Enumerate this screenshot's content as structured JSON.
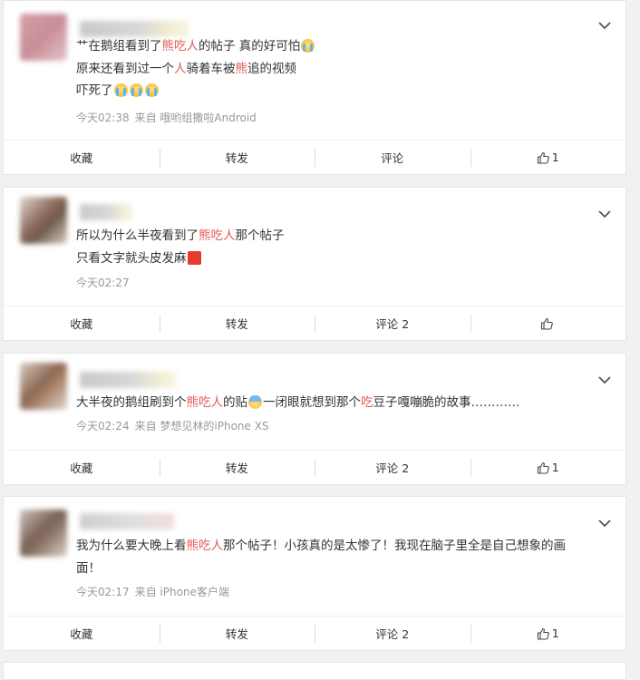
{
  "theme": {
    "highlight": "#e35b5b",
    "meta_text": "#999999",
    "background": "#f1f1f1"
  },
  "icons": {
    "expand": "chevron-down-icon",
    "like": "thumbs-up-icon",
    "cry_emoji": "crying-face-emoji",
    "cold_emoji": "cold-sweat-face-emoji",
    "sos_emoji": "sos-emoji"
  },
  "comments": [
    {
      "lines": [
        [
          {
            "t": "艹在鹅组看到了"
          },
          {
            "t": "熊吃人",
            "hl": true
          },
          {
            "t": "的帖子 真的好可怕"
          },
          {
            "emoji": "cry"
          }
        ],
        [
          {
            "t": "原来还看到过一个"
          },
          {
            "t": "人",
            "hl": true
          },
          {
            "t": "骑着车被"
          },
          {
            "t": "熊",
            "hl": true
          },
          {
            "t": "追的视频"
          }
        ],
        [
          {
            "t": "吓死了"
          },
          {
            "emoji": "cry"
          },
          {
            "emoji": "cry"
          },
          {
            "emoji": "cry"
          }
        ]
      ],
      "time": "今天02:38",
      "source": "来自 哦哟组撒啦Android",
      "actions": {
        "collect": "收藏",
        "repost": "转发",
        "comment": "评论",
        "like": "1"
      }
    },
    {
      "lines": [
        [
          {
            "t": "所以为什么半夜看到了"
          },
          {
            "t": "熊吃人",
            "hl": true
          },
          {
            "t": "那个帖子"
          }
        ],
        [
          {
            "t": "只看文字就头皮发麻"
          },
          {
            "emoji": "sos"
          }
        ]
      ],
      "time": "今天02:27",
      "source": "",
      "actions": {
        "collect": "收藏",
        "repost": "转发",
        "comment": "评论 2",
        "like": ""
      }
    },
    {
      "lines": [
        [
          {
            "t": "大半夜的鹅组刷到个"
          },
          {
            "t": "熊吃人",
            "hl": true
          },
          {
            "t": "的贴"
          },
          {
            "emoji": "cold"
          },
          {
            "t": "一闭眼就想到那个"
          },
          {
            "t": "吃",
            "hl": true
          },
          {
            "t": "豆子嘎嘣脆的故事…………"
          }
        ]
      ],
      "time": "今天02:24",
      "source": "来自 梦想见林的iPhone XS",
      "actions": {
        "collect": "收藏",
        "repost": "转发",
        "comment": "评论 2",
        "like": "1"
      }
    },
    {
      "lines": [
        [
          {
            "t": "我为什么要大晚上看"
          },
          {
            "t": "熊吃人",
            "hl": true
          },
          {
            "t": "那个帖子！小孩真的是太惨了！我现在脑子里全是自己想象的画"
          }
        ],
        [
          {
            "t": "面！"
          }
        ]
      ],
      "time": "今天02:17",
      "source": "来自 iPhone客户端",
      "actions": {
        "collect": "收藏",
        "repost": "转发",
        "comment": "评论 2",
        "like": "1"
      }
    }
  ]
}
